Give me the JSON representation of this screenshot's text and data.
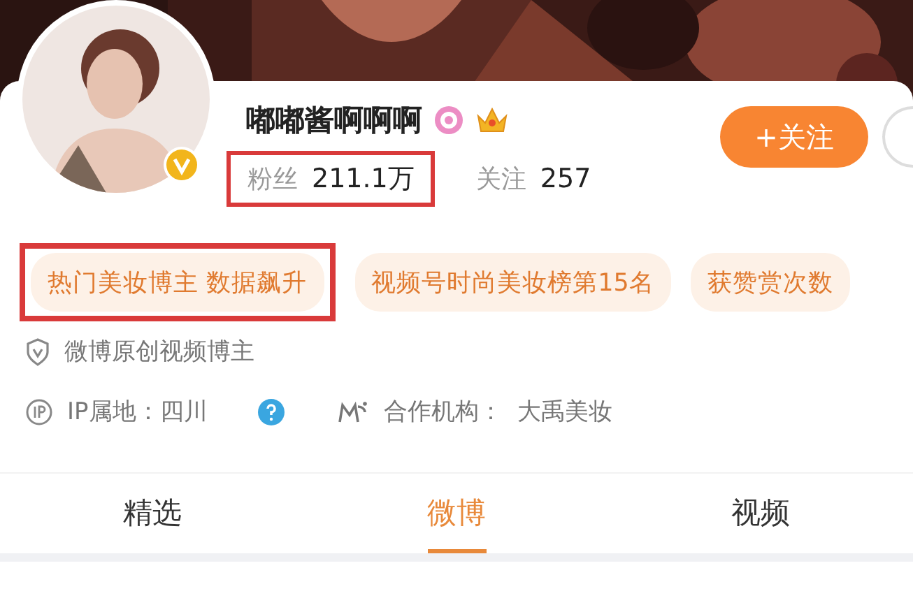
{
  "profile": {
    "name": "嘟嘟酱啊啊啊",
    "verified": true,
    "follow_button": "+关注"
  },
  "stats": [
    {
      "label": "粉丝",
      "value": "211.1万",
      "highlighted": true
    },
    {
      "label": "关注",
      "value": "257",
      "highlighted": false
    }
  ],
  "tags": [
    {
      "text": "热门美妆博主 数据飙升",
      "highlighted": true
    },
    {
      "text": "视频号时尚美妆榜第15名",
      "highlighted": false
    },
    {
      "text": "获赞赏次数",
      "highlighted": false
    }
  ],
  "info": [
    {
      "kind": "badge",
      "text": "微博原创视频博主"
    },
    {
      "kind": "ip",
      "text": "IP属地：四川",
      "help": true
    },
    {
      "kind": "org",
      "text": "合作机构：  大禹美妆"
    }
  ],
  "tabs": [
    {
      "label": "精选",
      "selected": false
    },
    {
      "label": "微博",
      "selected": true
    },
    {
      "label": "视频",
      "selected": false
    }
  ]
}
